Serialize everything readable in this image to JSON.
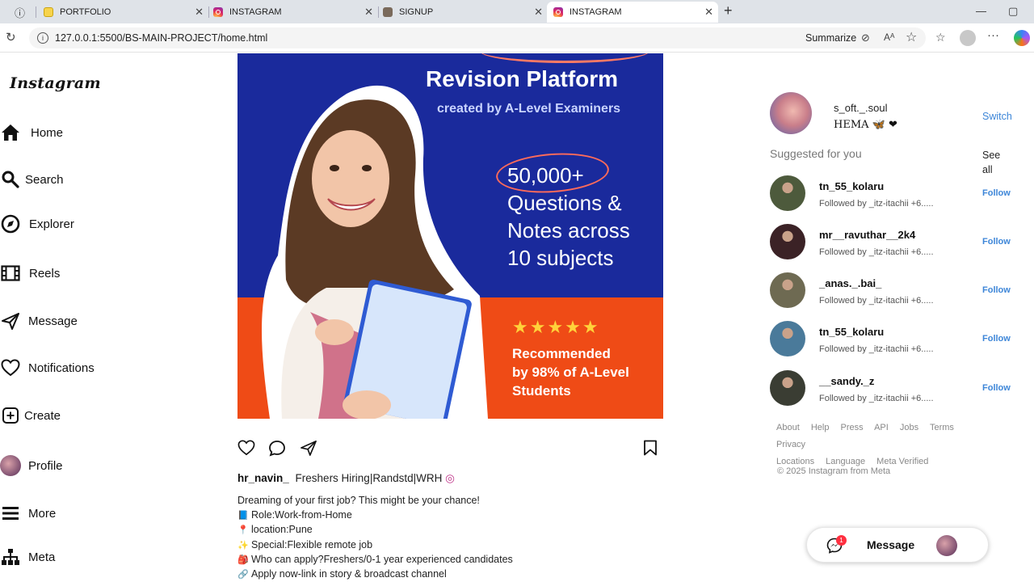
{
  "browser": {
    "tabs": [
      {
        "label": "PORTFOLIO",
        "favicon": "portfolio-icon",
        "active": false
      },
      {
        "label": "INSTAGRAM",
        "favicon": "instagram-icon",
        "active": false
      },
      {
        "label": "SIGNUP",
        "favicon": "signup-icon",
        "active": false
      },
      {
        "label": "INSTAGRAM",
        "favicon": "instagram-icon",
        "active": true
      }
    ],
    "url": "127.0.0.1:5500/BS-MAIN-PROJECT/home.html",
    "summarize_label": "Summarize"
  },
  "sidebar": {
    "logo": "Instagram",
    "items": [
      {
        "label": "Home",
        "icon": "home-icon"
      },
      {
        "label": "Search",
        "icon": "search-icon"
      },
      {
        "label": "Explorer",
        "icon": "compass-icon"
      },
      {
        "label": "Reels",
        "icon": "reels-icon"
      },
      {
        "label": "Message",
        "icon": "send-icon"
      },
      {
        "label": "Notifications",
        "icon": "heart-icon"
      },
      {
        "label": "Create",
        "icon": "plus-square-icon"
      },
      {
        "label": "Profile",
        "icon": "avatar-icon"
      },
      {
        "label": "More",
        "icon": "menu-icon"
      },
      {
        "label": "Meta",
        "icon": "sitemap-icon"
      }
    ]
  },
  "post": {
    "image": {
      "title": "Revision Platform",
      "subtitle": "created by A-Level Examiners",
      "headline": [
        "50,000+",
        "Questions &",
        "Notes across",
        "10 subjects"
      ],
      "stars": "★★★★★",
      "recommend": [
        "Recommended",
        "by 98% of A-Level",
        "Students"
      ]
    },
    "username": "hr_navin_",
    "title": "Freshers Hiring|Randstd|WRH",
    "lines": [
      {
        "emoji": "",
        "text": "Dreaming of your first job? This might be your chance!"
      },
      {
        "emoji": "📘",
        "text": "Role:Work-from-Home"
      },
      {
        "emoji": "📍",
        "text": "location:Pune"
      },
      {
        "emoji": "✨",
        "text": "Special:Flexible remote job"
      },
      {
        "emoji": "🎒",
        "text": "Who can apply?Freshers/0-1 year experienced candidates"
      },
      {
        "emoji": "🔗",
        "text": "Apply now-link in story & broadcast channel"
      }
    ]
  },
  "profile": {
    "username": "s_oft._.soul",
    "name": "HEMA 🦋 ❤",
    "switch_label": "Switch"
  },
  "suggestions": {
    "heading": "Suggested for you",
    "see_all": "See all",
    "items": [
      {
        "username": "tn_55_kolaru",
        "followed_by": "Followed by _itz-itachii +6.....",
        "follow": "Follow",
        "color": "#4d5a3c"
      },
      {
        "username": "mr__ravuthar__2k4",
        "followed_by": "Followed by _itz-itachii +6.....",
        "follow": "Follow",
        "color": "#3b2226"
      },
      {
        "username": "_anas._.bai_",
        "followed_by": "Followed by _itz-itachii +6.....",
        "follow": "Follow",
        "color": "#6e6a52"
      },
      {
        "username": "tn_55_kolaru",
        "followed_by": "Followed by _itz-itachii +6.....",
        "follow": "Follow",
        "color": "#4a7a9a"
      },
      {
        "username": "__sandy._z",
        "followed_by": "Followed by _itz-itachii +6.....",
        "follow": "Follow",
        "color": "#3a3d33"
      }
    ]
  },
  "footer": {
    "links": [
      "About",
      "Help",
      "Press",
      "API",
      "Jobs",
      "Terms",
      "Privacy",
      "Locations",
      "Language",
      "Meta Verified"
    ],
    "copyright": "© 2025 Instagram from Meta"
  },
  "message_bar": {
    "label": "Message",
    "badge": "1"
  }
}
